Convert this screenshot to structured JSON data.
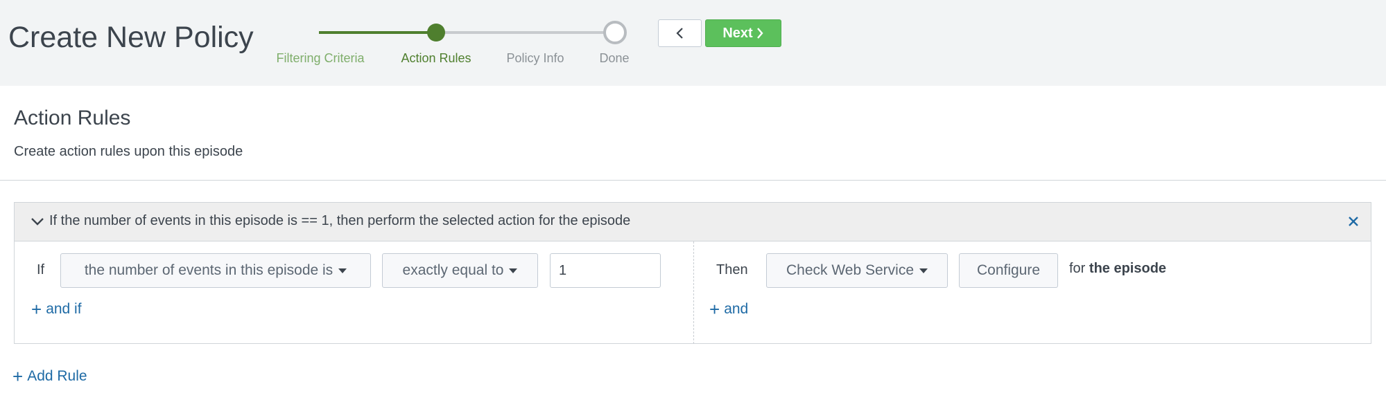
{
  "header": {
    "title": "Create New Policy",
    "steps": [
      {
        "label": "Filtering Criteria",
        "state": "done"
      },
      {
        "label": "Action Rules",
        "state": "active"
      },
      {
        "label": "Policy Info",
        "state": "pending"
      },
      {
        "label": "Done",
        "state": "pending"
      }
    ],
    "back_icon": "chevron-left-icon",
    "next_label": "Next",
    "next_icon": "chevron-right-icon"
  },
  "section": {
    "title": "Action Rules",
    "description": "Create action rules upon this episode"
  },
  "rule": {
    "summary": "If the number of events in this episode is == 1, then perform the selected action for the episode",
    "collapse_icon": "chevron-down-icon",
    "remove_icon": "close-icon",
    "if_label": "If",
    "condition_field": "the number of events in this episode is",
    "condition_operator": "exactly equal to",
    "condition_value": "1",
    "and_if_label": "and if",
    "then_label": "Then",
    "action": "Check Web Service",
    "configure_label": "Configure",
    "for_prefix": "for",
    "for_target": "the episode",
    "and_label": "and"
  },
  "add_rule_label": "Add Rule",
  "colors": {
    "accent_green": "#5cc05c",
    "step_active": "#4f7f2e",
    "link_blue": "#1e6aa5"
  }
}
